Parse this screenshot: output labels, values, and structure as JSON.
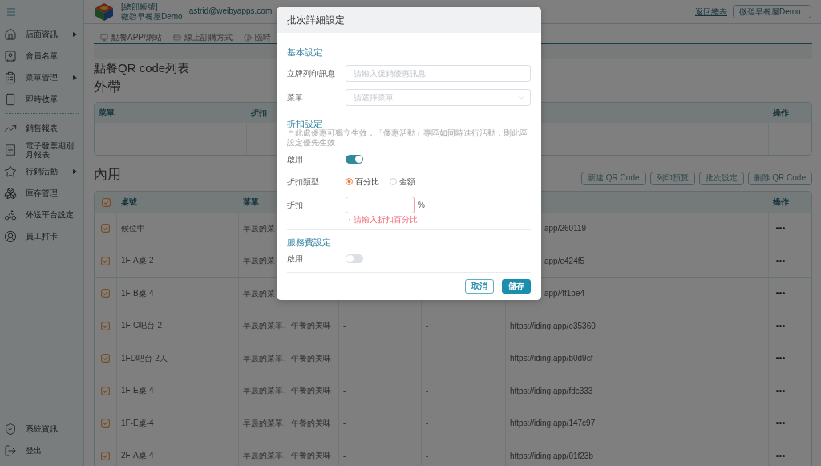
{
  "header": {
    "account_label": "[總部帳號]",
    "store_name": "微碧早餐屋Demo",
    "email": "astrid@weibyapps.com",
    "back_link": "返回總表",
    "store_select": {
      "value": "微碧早餐屋Demo"
    }
  },
  "sidebar": {
    "groups": [
      {
        "items": [
          {
            "label": "店面資訊",
            "has_submenu": true
          },
          {
            "label": "會員名單",
            "has_submenu": false
          },
          {
            "label": "菜單管理",
            "has_submenu": true
          },
          {
            "label": "即時收單",
            "has_submenu": false
          }
        ]
      },
      {
        "items": [
          {
            "label": "銷售報表",
            "has_submenu": false
          },
          {
            "label": "電子發票期別月報表",
            "has_submenu": false
          },
          {
            "label": "行銷活動",
            "has_submenu": true
          },
          {
            "label": "庫存管理",
            "has_submenu": false
          },
          {
            "label": "外送平台設定",
            "has_submenu": false
          },
          {
            "label": "員工打卡",
            "has_submenu": false
          }
        ]
      }
    ],
    "bottom_items": [
      {
        "label": "系統資訊"
      },
      {
        "label": "登出"
      }
    ]
  },
  "tabs": [
    "點餐APP/網站",
    "線上訂購方式",
    "臨時"
  ],
  "page_title": "點餐QR code列表",
  "takeout": {
    "title": "外帶",
    "table": {
      "columns": {
        "menu": "菜單",
        "discount": "折扣",
        "actions": "操作"
      },
      "rows": [
        {
          "menu": "-",
          "discount": "-"
        }
      ]
    }
  },
  "dine_in": {
    "title": "內用",
    "buttons": [
      "新建 QR Code",
      "列印預覽",
      "批次設定",
      "刪除 QR Code"
    ],
    "table": {
      "select_all": {
        "checked": true
      },
      "columns": {
        "table_no": "桌號",
        "menu": "菜單",
        "actions": "操作"
      },
      "rows": [
        {
          "checked": true,
          "table_no": "候位中",
          "menu": "早晨的菜",
          "column_6": "app/260119"
        },
        {
          "checked": true,
          "table_no": "1F-A桌-2",
          "menu": "早晨的菜",
          "column_6": "app/e424f5"
        },
        {
          "checked": true,
          "table_no": "1F-B桌-4",
          "menu": "早晨的菜",
          "column_6": "app/4f1be4"
        },
        {
          "checked": true,
          "table_no": "1F-C吧台-2",
          "menu": "早晨的菜單、午餐的美味",
          "column_4": "-",
          "column_5": "-",
          "column_6": "https://iding.app/e35360"
        },
        {
          "checked": true,
          "table_no": "1FD吧台-2人",
          "menu": "早晨的菜單、午餐的美味",
          "column_4": "-",
          "column_5": "-",
          "column_6": "https://iding.app/b0d9cf"
        },
        {
          "checked": true,
          "table_no": "1F-E桌-4",
          "menu": "早晨的菜單、午餐的美味",
          "column_4": "-",
          "column_5": "-",
          "column_6": "https://iding.app/fdc333"
        },
        {
          "checked": true,
          "table_no": "1F-E桌-4",
          "menu": "早晨的菜單、午餐的美味",
          "column_4": "-",
          "column_5": "-",
          "column_6": "https://iding.app/147c97"
        },
        {
          "checked": true,
          "table_no": "2F-A桌-4",
          "menu": "早晨的菜單、午餐的美味",
          "column_4": "-",
          "column_5": "-",
          "column_6": "https://iding.app/01f23b"
        }
      ]
    }
  },
  "modal": {
    "title": "批次詳細設定",
    "sections": [
      {
        "title": "基本設定",
        "fields": [
          {
            "kind": "text",
            "label": "立牌列印訊息",
            "placeholder": "請輸入促銷優惠訊息"
          },
          {
            "kind": "select",
            "label": "菜單",
            "placeholder": "請選擇菜單"
          }
        ]
      },
      {
        "title": "折扣設定",
        "note": "＊此處優惠可獨立生效，「優惠活動」專區如同時進行活動，則此區設定優先生效",
        "fields": [
          {
            "kind": "toggle",
            "label": "啟用",
            "on": true
          },
          {
            "kind": "radio",
            "label": "折扣類型",
            "options": [
              {
                "label": "百分比",
                "selected": true
              },
              {
                "label": "金額",
                "selected": false
              }
            ]
          },
          {
            "kind": "number",
            "label": "折扣",
            "suffix": "%",
            "invalid": true,
            "error": "・請輸入折扣百分比"
          }
        ]
      },
      {
        "title": "服務費設定",
        "fields": [
          {
            "kind": "toggle",
            "label": "啟用",
            "on": false
          }
        ]
      }
    ],
    "buttons": [
      {
        "kind": "secondary",
        "label": "取消"
      },
      {
        "kind": "primary",
        "label": "儲存"
      }
    ]
  }
}
